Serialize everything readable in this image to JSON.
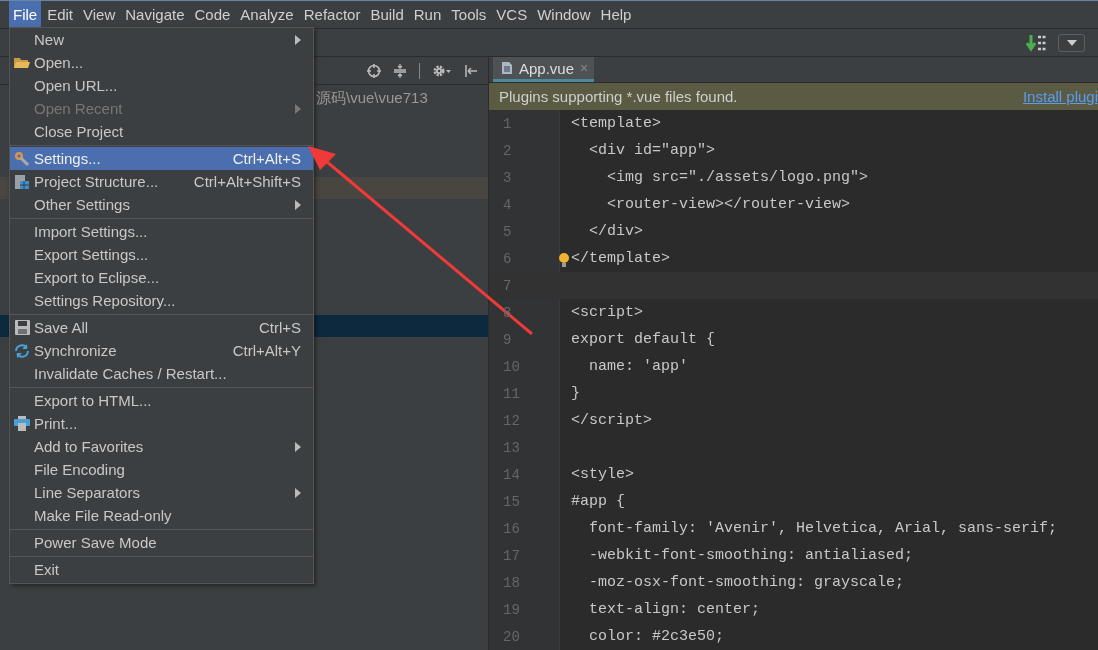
{
  "menubar": [
    {
      "label": "File",
      "selected": true
    },
    {
      "label": "Edit",
      "selected": false
    },
    {
      "label": "View",
      "selected": false
    },
    {
      "label": "Navigate",
      "selected": false
    },
    {
      "label": "Code",
      "selected": false
    },
    {
      "label": "Analyze",
      "selected": false
    },
    {
      "label": "Refactor",
      "selected": false
    },
    {
      "label": "Build",
      "selected": false
    },
    {
      "label": "Run",
      "selected": false
    },
    {
      "label": "Tools",
      "selected": false
    },
    {
      "label": "VCS",
      "selected": false
    },
    {
      "label": "Window",
      "selected": false
    },
    {
      "label": "Help",
      "selected": false
    }
  ],
  "file_menu": [
    {
      "kind": "item",
      "label": "New",
      "submenu": true,
      "disabled": false,
      "selected": false
    },
    {
      "kind": "item",
      "label": "Open...",
      "submenu": false,
      "disabled": false,
      "selected": false
    },
    {
      "kind": "item",
      "label": "Open URL...",
      "submenu": false,
      "disabled": false,
      "selected": false
    },
    {
      "kind": "item",
      "label": "Open Recent",
      "submenu": true,
      "disabled": true,
      "selected": false
    },
    {
      "kind": "item",
      "label": "Close Project",
      "submenu": false,
      "disabled": false,
      "selected": false
    },
    {
      "kind": "separator"
    },
    {
      "kind": "item",
      "label": "Settings...",
      "shortcut": "Ctrl+Alt+S",
      "submenu": false,
      "disabled": false,
      "selected": true
    },
    {
      "kind": "item",
      "label": "Project Structure...",
      "shortcut": "Ctrl+Alt+Shift+S",
      "submenu": false,
      "disabled": false,
      "selected": false
    },
    {
      "kind": "item",
      "label": "Other Settings",
      "submenu": true,
      "disabled": false,
      "selected": false
    },
    {
      "kind": "separator"
    },
    {
      "kind": "item",
      "label": "Import Settings...",
      "submenu": false,
      "disabled": false,
      "selected": false
    },
    {
      "kind": "item",
      "label": "Export Settings...",
      "submenu": false,
      "disabled": false,
      "selected": false
    },
    {
      "kind": "item",
      "label": "Export to Eclipse...",
      "submenu": false,
      "disabled": false,
      "selected": false
    },
    {
      "kind": "item",
      "label": "Settings Repository...",
      "submenu": false,
      "disabled": false,
      "selected": false
    },
    {
      "kind": "separator"
    },
    {
      "kind": "item",
      "label": "Save All",
      "shortcut": "Ctrl+S",
      "submenu": false,
      "disabled": false,
      "selected": false
    },
    {
      "kind": "item",
      "label": "Synchronize",
      "shortcut": "Ctrl+Alt+Y",
      "submenu": false,
      "disabled": false,
      "selected": false
    },
    {
      "kind": "item",
      "label": "Invalidate Caches / Restart...",
      "submenu": false,
      "disabled": false,
      "selected": false
    },
    {
      "kind": "separator"
    },
    {
      "kind": "item",
      "label": "Export to HTML...",
      "submenu": false,
      "disabled": false,
      "selected": false
    },
    {
      "kind": "item",
      "label": "Print...",
      "submenu": false,
      "disabled": false,
      "selected": false
    },
    {
      "kind": "item",
      "label": "Add to Favorites",
      "submenu": true,
      "disabled": false,
      "selected": false
    },
    {
      "kind": "item",
      "label": "File Encoding",
      "submenu": false,
      "disabled": false,
      "selected": false
    },
    {
      "kind": "item",
      "label": "Line Separators",
      "submenu": true,
      "disabled": false,
      "selected": false
    },
    {
      "kind": "item",
      "label": "Make File Read-only",
      "submenu": false,
      "disabled": false,
      "selected": false
    },
    {
      "kind": "separator"
    },
    {
      "kind": "item",
      "label": "Power Save Mode",
      "submenu": false,
      "disabled": false,
      "selected": false
    },
    {
      "kind": "separator"
    },
    {
      "kind": "item",
      "label": "Exit",
      "submenu": false,
      "disabled": false,
      "selected": false
    }
  ],
  "project_panel": {
    "path": "源码\\vue\\vue713"
  },
  "editor": {
    "tabs": [
      {
        "label": "App.vue",
        "close": "×",
        "selected": true
      }
    ],
    "notification": {
      "message": "Plugins supporting *.vue files found.",
      "link": "Install plugi"
    },
    "lines": [
      {
        "number": "1",
        "text": "<template>"
      },
      {
        "number": "2",
        "text": "  <div id=\"app\">"
      },
      {
        "number": "3",
        "text": "    <img src=\"./assets/logo.png\">"
      },
      {
        "number": "4",
        "text": "    <router-view></router-view>"
      },
      {
        "number": "5",
        "text": "  </div>"
      },
      {
        "number": "6",
        "text": "</template>",
        "bulb": true
      },
      {
        "number": "7",
        "current": true
      },
      {
        "number": "8",
        "text": "<script>"
      },
      {
        "number": "9",
        "text": "export default {"
      },
      {
        "number": "10",
        "text": "  name: 'app'"
      },
      {
        "number": "11",
        "text": "}"
      },
      {
        "number": "12",
        "text": "</script>"
      },
      {
        "number": "13"
      },
      {
        "number": "14",
        "text": "<style>"
      },
      {
        "number": "15",
        "text": "#app {"
      },
      {
        "number": "16",
        "text": "  font-family: 'Avenir', Helvetica, Arial, sans-serif;"
      },
      {
        "number": "17",
        "text": "  -webkit-font-smoothing: antialiased;"
      },
      {
        "number": "18",
        "text": "  -moz-osx-font-smoothing: grayscale;"
      },
      {
        "number": "19",
        "text": "  text-align: center;"
      },
      {
        "number": "20",
        "text": "  color: #2c3e50;"
      }
    ]
  }
}
